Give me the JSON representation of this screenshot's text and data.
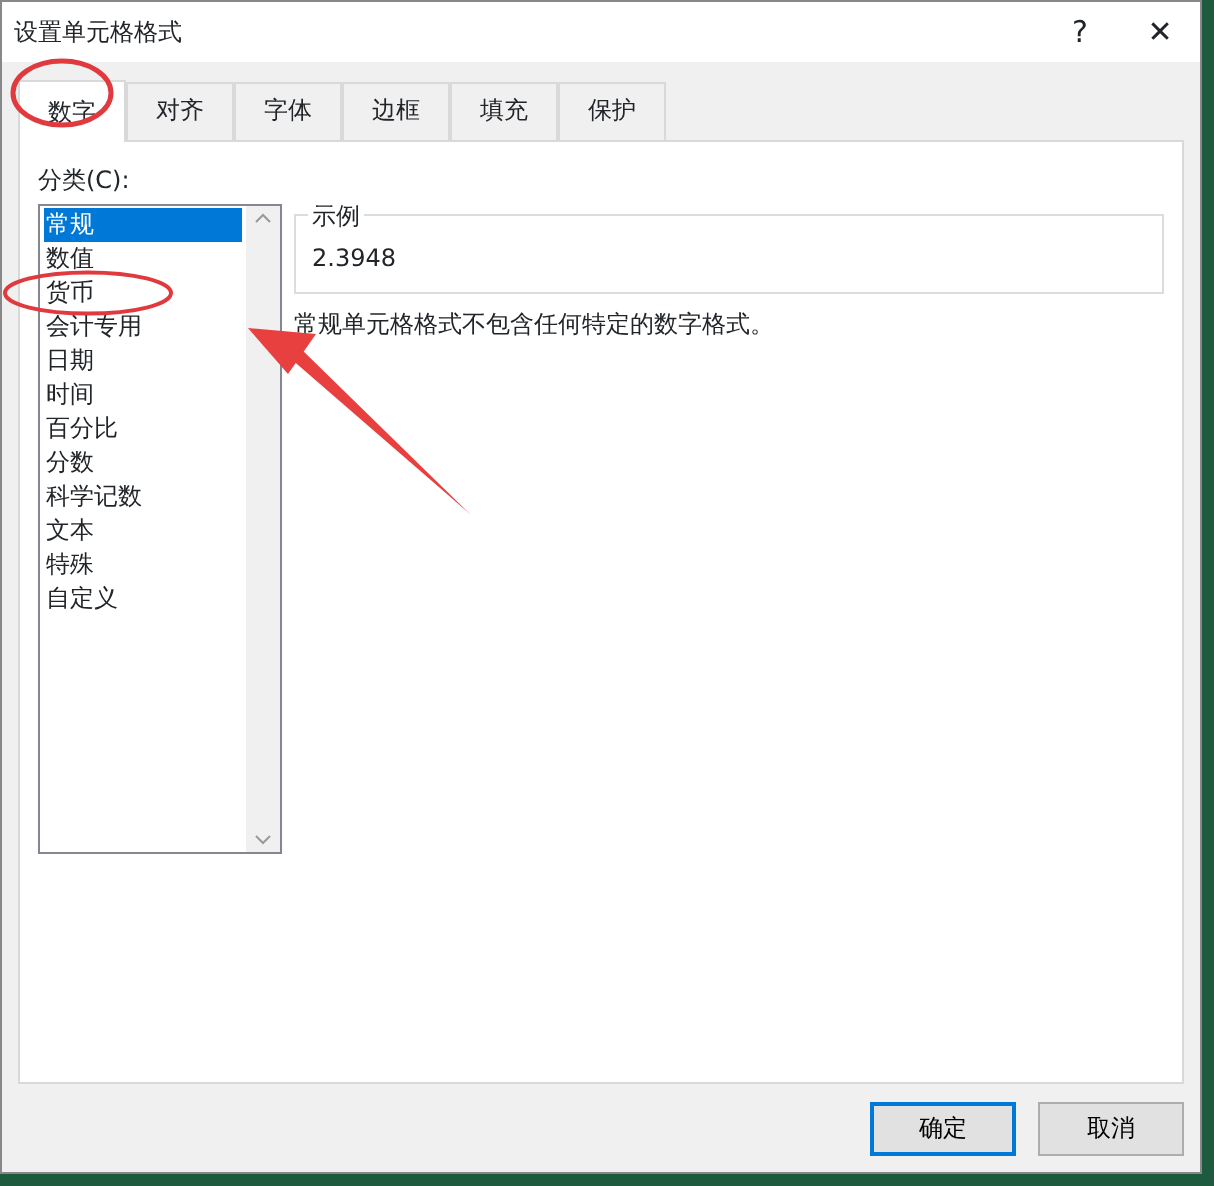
{
  "window": {
    "title": "设置单元格格式",
    "help": "?",
    "close": "✕"
  },
  "tabs": [
    {
      "label": "数字",
      "selected": true
    },
    {
      "label": "对齐",
      "selected": false
    },
    {
      "label": "字体",
      "selected": false
    },
    {
      "label": "边框",
      "selected": false
    },
    {
      "label": "填充",
      "selected": false
    },
    {
      "label": "保护",
      "selected": false
    }
  ],
  "category": {
    "label": "分类(C):",
    "items": [
      {
        "label": "常规",
        "selected": true
      },
      {
        "label": "数值",
        "selected": false
      },
      {
        "label": "货币",
        "selected": false
      },
      {
        "label": "会计专用",
        "selected": false
      },
      {
        "label": "日期",
        "selected": false
      },
      {
        "label": "时间",
        "selected": false
      },
      {
        "label": "百分比",
        "selected": false
      },
      {
        "label": "分数",
        "selected": false
      },
      {
        "label": "科学记数",
        "selected": false
      },
      {
        "label": "文本",
        "selected": false
      },
      {
        "label": "特殊",
        "selected": false
      },
      {
        "label": "自定义",
        "selected": false
      }
    ]
  },
  "sample": {
    "label": "示例",
    "value": "2.3948"
  },
  "description": "常规单元格格式不包含任何特定的数字格式。",
  "buttons": [
    {
      "label": "确定",
      "kind": "default"
    },
    {
      "label": "取消",
      "kind": "normal"
    }
  ]
}
